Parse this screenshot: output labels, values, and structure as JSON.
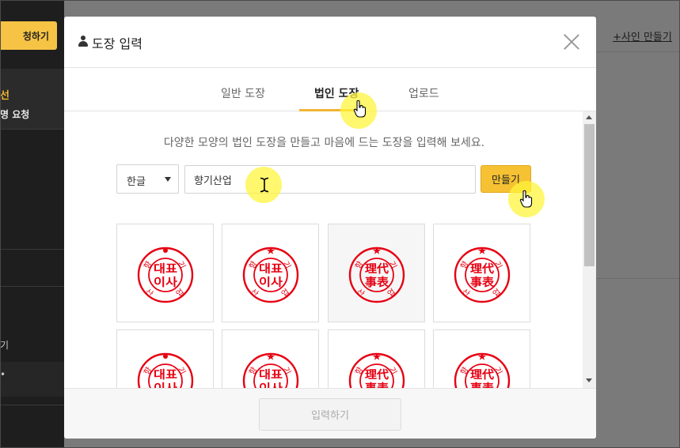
{
  "background": {
    "sidebar_button": "청하기",
    "sidebar_item_active": "선",
    "sidebar_item_sub": "명 요청",
    "sidebar_item_lower": "기",
    "sidebar_item_bottom": "•",
    "create_sign_link": "+사인 만들기"
  },
  "modal": {
    "title": "도장 입력",
    "tabs": [
      {
        "label": "일반 도장",
        "active": false
      },
      {
        "label": "법인 도장",
        "active": true
      },
      {
        "label": "업로드",
        "active": false
      }
    ],
    "description": "다양한 모양의 법인 도장을 만들고 마음에 드는 도장을 입력해 보세요.",
    "language_select": {
      "value": "한글"
    },
    "name_input": {
      "value": "향기산업"
    },
    "make_button": "만들기",
    "submit_button": "입력하기",
    "stamps": [
      {
        "center_top": "대표",
        "center_bottom": "이사",
        "selected": false
      },
      {
        "center_top": "대표",
        "center_bottom": "이사",
        "selected": false
      },
      {
        "center_top": "理代",
        "center_bottom": "事表",
        "selected": true
      },
      {
        "center_top": "理代",
        "center_bottom": "事表",
        "selected": false
      },
      {
        "center_top": "대표",
        "center_bottom": "이사",
        "selected": false
      },
      {
        "center_top": "대표",
        "center_bottom": "이사",
        "selected": false
      },
      {
        "center_top": "理代",
        "center_bottom": "事表",
        "selected": false
      },
      {
        "center_top": "理代",
        "center_bottom": "事表",
        "selected": false
      }
    ],
    "stamp_ring_text": [
      "향",
      "기",
      "산",
      "업"
    ]
  },
  "colors": {
    "accent": "#f6c233",
    "tab_underline": "#f2b534",
    "stamp_red": "#e60012",
    "cursor_highlight": "#fff43c"
  },
  "icons": [
    "user-icon",
    "close-icon",
    "caret-down-icon",
    "hand-cursor-icon",
    "text-cursor-icon"
  ]
}
